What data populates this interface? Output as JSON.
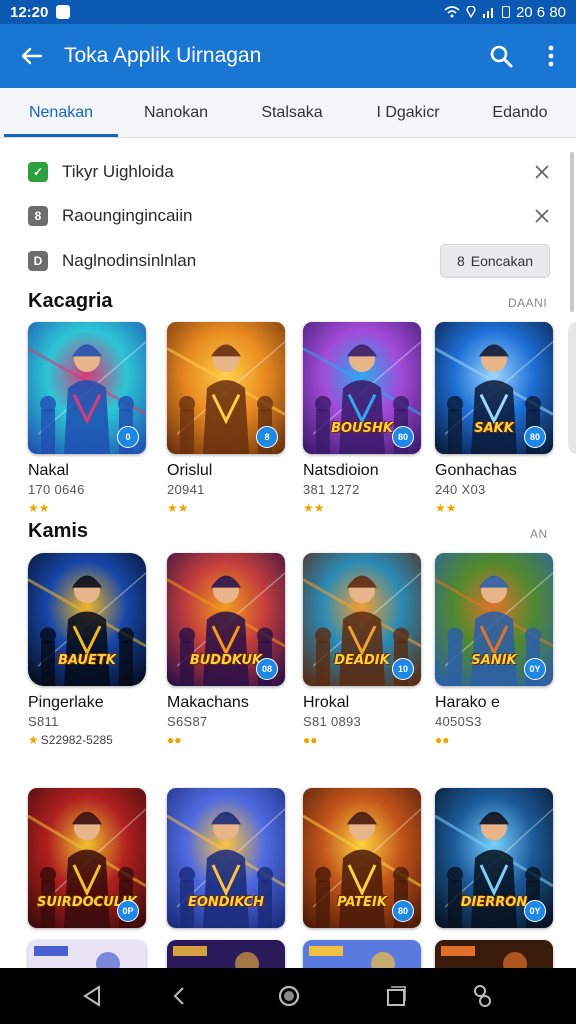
{
  "status_bar": {
    "time": "12:20",
    "right_text": "20 6 80"
  },
  "app_bar": {
    "title": "Toka Applik Uirnagan",
    "back_icon": "arrow-left-icon",
    "search_icon": "search-icon",
    "more_icon": "more-vert-icon"
  },
  "tabs": [
    {
      "label": "Nenakan",
      "active": true
    },
    {
      "label": "Nanokan",
      "active": false
    },
    {
      "label": "Stalsaka",
      "active": false
    },
    {
      "label": "I Dgakicr",
      "active": false
    },
    {
      "label": "Edando",
      "active": false
    }
  ],
  "notifications": [
    {
      "text": "Tikyr Uighloida",
      "icon": "check-icon",
      "color": "#2e9e3e",
      "glyph": "✓"
    },
    {
      "text": "Raoungingincaiin",
      "icon": "badge-icon",
      "color": "#6d6d6d",
      "glyph": "8"
    },
    {
      "text": "Naglnodinsinlnlan",
      "icon": "device-icon",
      "color": "#6d6d6d",
      "glyph": "D"
    }
  ],
  "notif_action": {
    "label": "Eoncakan",
    "glyph": "8"
  },
  "sections": [
    {
      "title": "Kacagria",
      "more": "DAANI"
    },
    {
      "title": "Kamis",
      "more": "AN"
    }
  ],
  "row1": [
    {
      "name": "Nakal",
      "meta": "170 0646",
      "stars": "★★",
      "badge": "0",
      "c1": "#1f4fb0",
      "c2": "#2cc6d6",
      "c3": "#d83a7a"
    },
    {
      "name": "Orislul",
      "meta": "20941",
      "stars": "★★",
      "badge": "8",
      "c1": "#6a2f0f",
      "c2": "#e88a20",
      "c3": "#ffcf4a"
    },
    {
      "name": "Natsdioion",
      "meta": "381 1272",
      "stars": "★★",
      "badge": "80",
      "banner": "BOUSHK",
      "c1": "#3a1a6a",
      "c2": "#a34ad8",
      "c3": "#2ea8f0"
    },
    {
      "name": "Gonhachas",
      "meta": "240 X03",
      "stars": "★★",
      "badge": "80",
      "banner": "SAKK",
      "c1": "#0a1a3a",
      "c2": "#1e6fd6",
      "c3": "#9bd7ff"
    }
  ],
  "row2": [
    {
      "name": "Pingerlake",
      "meta": "S811",
      "stars": "★",
      "stars_text": "S22982-5285",
      "banner": "BAUETK",
      "c1": "#050a18",
      "c2": "#1746a8",
      "c3": "#f1b628"
    },
    {
      "name": "Makachans",
      "meta": "S6S87",
      "stars": "●●",
      "badge": "08",
      "banner": "BUDDKUK",
      "c1": "#2a0f45",
      "c2": "#c23d3d",
      "c3": "#f59a1e"
    },
    {
      "name": "Hrokal",
      "meta": "S81 0893",
      "stars": "●●",
      "badge": "10",
      "banner": "DEADIK",
      "c1": "#5a2a10",
      "c2": "#2a8ab5",
      "c3": "#f2a030"
    },
    {
      "name": "Harako e",
      "meta": "4050S3",
      "stars": "●●",
      "badge": "0Y",
      "banner": "SANIK",
      "c1": "#2c5ea8",
      "c2": "#4f8a2f",
      "c3": "#e0732a"
    }
  ],
  "row3": [
    {
      "badge": "0P",
      "banner": "SUIRDOCULIK",
      "c1": "#3a0a0a",
      "c2": "#b02020",
      "c3": "#f0c030"
    },
    {
      "badge": "",
      "banner": "EONDIKCH",
      "c1": "#1a2a7a",
      "c2": "#4f6ae0",
      "c3": "#ffc240"
    },
    {
      "badge": "80",
      "banner": "PATEIK",
      "c1": "#4a1a08",
      "c2": "#c2541a",
      "c3": "#ffd040"
    },
    {
      "badge": "0Y",
      "banner": "DIERRON",
      "c1": "#07111f",
      "c2": "#1b5a9a",
      "c3": "#7ad0ff"
    }
  ],
  "nav": {
    "back": "back-icon",
    "recents_alt": "squiggle-icon",
    "home": "home-icon",
    "recents": "recents-icon",
    "assist": "assist-icon"
  }
}
